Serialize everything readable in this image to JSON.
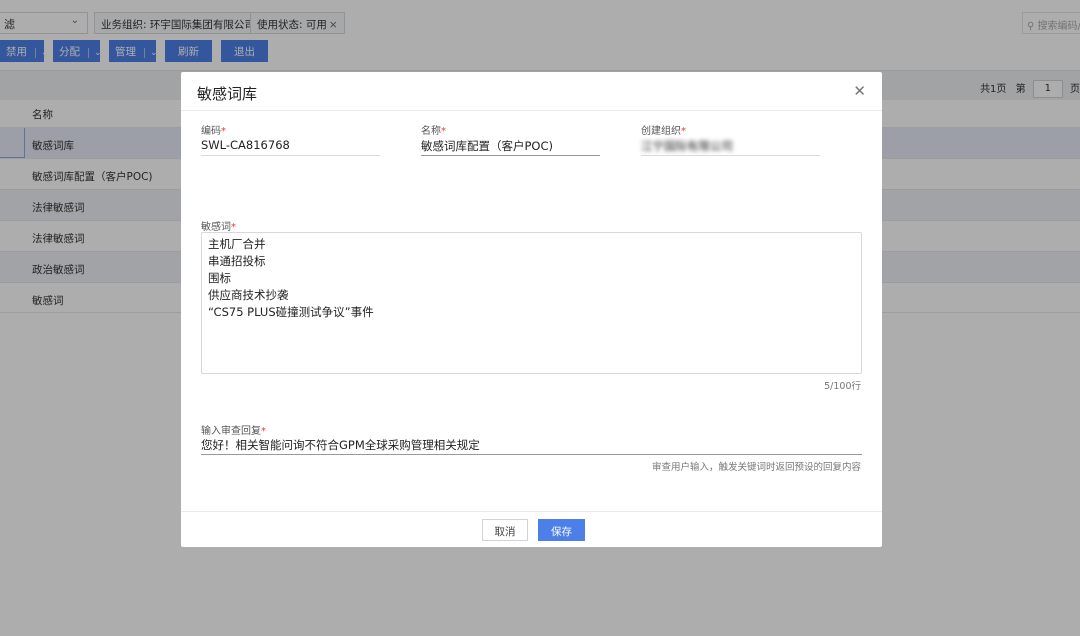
{
  "background": {
    "filter_select": "滤",
    "filter_tags": [
      {
        "label": "业务组织: 环宇国际集团有限公司",
        "closable": false
      },
      {
        "label": "使用状态: 可用",
        "closable": true
      }
    ],
    "search_placeholder": "搜索编码/",
    "toolbar": [
      {
        "label": "禁用",
        "dropdown": true
      },
      {
        "label": "分配",
        "dropdown": true
      },
      {
        "label": "管理",
        "dropdown": true
      },
      {
        "label": "刷新",
        "dropdown": false
      },
      {
        "label": "退出",
        "dropdown": false
      }
    ],
    "pager": {
      "total": "共1页",
      "page_prefix": "第",
      "page": "1",
      "page_suffix": "页"
    },
    "column_header": "名称",
    "rows": [
      "敏感词库",
      "敏感词库配置（客户POC)",
      "法律敏感词",
      "法律敏感词",
      "政治敏感词",
      "敏感词"
    ]
  },
  "modal": {
    "title": "敏感词库",
    "close_icon": "close-icon",
    "code_label": "编码",
    "code_value": "SWL-CA816768",
    "name_label": "名称",
    "name_value": "敏感词库配置（客户POC)",
    "org_label": "创建组织",
    "org_value_obscured": "江宁国际有限公司",
    "words_label": "敏感词",
    "words": [
      "主机厂合并",
      "串通招投标",
      "围标",
      "供应商技术抄袭",
      "“CS75 PLUS碰撞测试争议”事件"
    ],
    "words_counter": "5/100行",
    "reply_label": "输入审查回复",
    "reply_value": "您好！相关智能问询不符合GPM全球采购管理相关规定",
    "reply_hint": "审查用户输入，触发关键词时返回预设的回复内容",
    "cancel_label": "取消",
    "save_label": "保存"
  },
  "colors": {
    "primary": "#4d7fe8",
    "required": "#e53935"
  }
}
